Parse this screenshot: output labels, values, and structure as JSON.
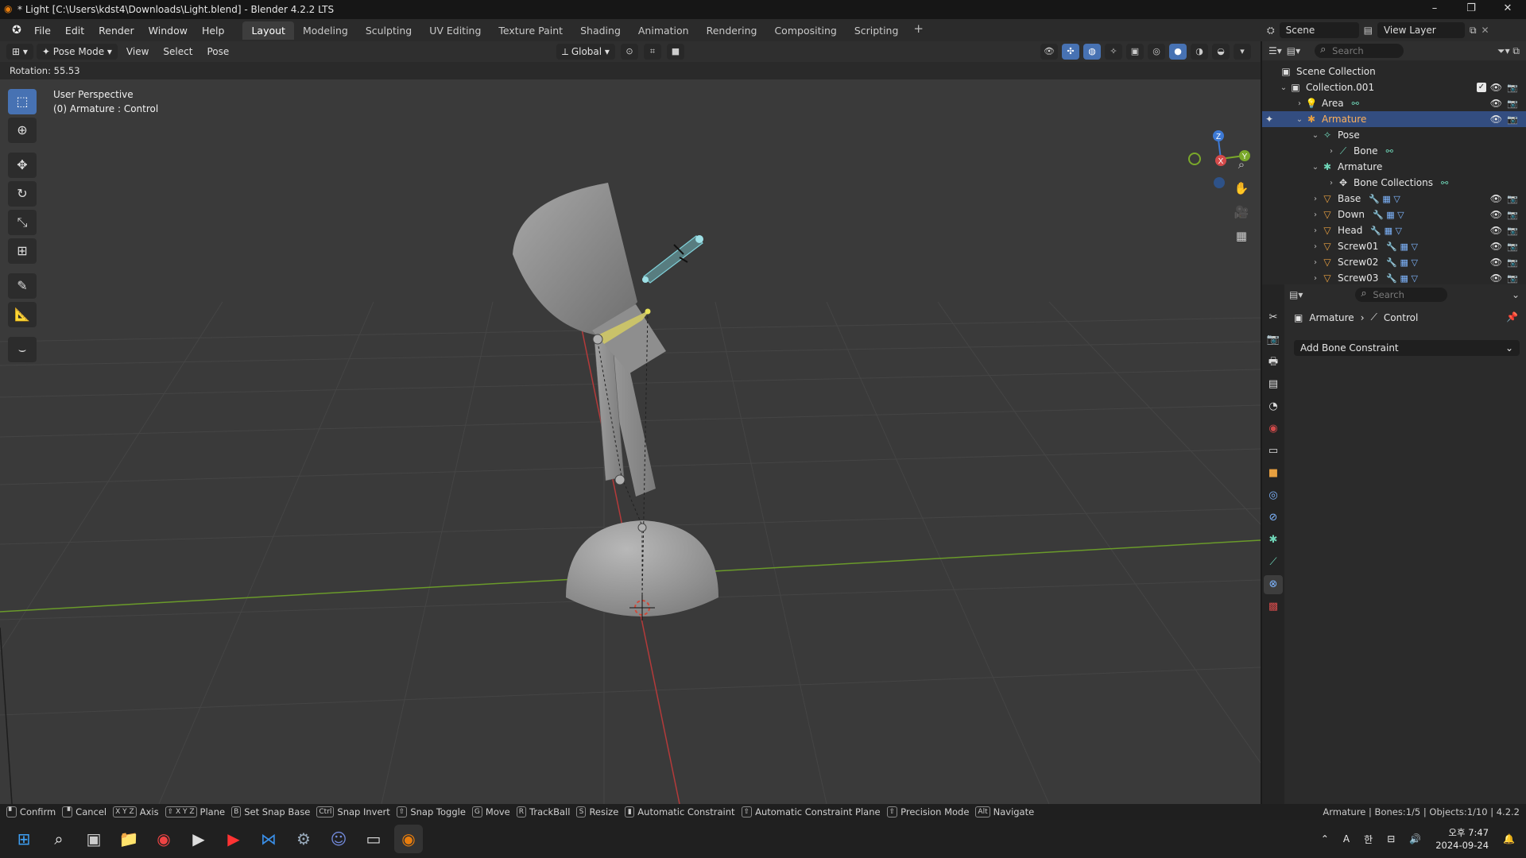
{
  "window": {
    "title": "* Light [C:\\Users\\kdst4\\Downloads\\Light.blend] - Blender 4.2.2 LTS",
    "controls": [
      "–",
      "❐",
      "✕"
    ]
  },
  "menubar": {
    "logo_icon": "blender-logo-icon",
    "menus": [
      "File",
      "Edit",
      "Render",
      "Window",
      "Help"
    ],
    "workspaces": [
      "Layout",
      "Modeling",
      "Sculpting",
      "UV Editing",
      "Texture Paint",
      "Shading",
      "Animation",
      "Rendering",
      "Compositing",
      "Scripting"
    ],
    "active_workspace": "Layout",
    "add_workspace": "+",
    "scene": "Scene",
    "view_layer": "View Layer"
  },
  "viewport": {
    "mode": "Pose Mode",
    "menus": [
      "View",
      "Select",
      "Pose"
    ],
    "transform_orientation": "Global",
    "rotation_readout": "Rotation: 55.53",
    "perspective_label": "User Perspective",
    "active_label": "(0) Armature : Control",
    "axes": {
      "x": "X",
      "y": "Y",
      "z": "Z"
    },
    "colors": {
      "background": "#3a3a3a",
      "grid": "#454545",
      "x_axis": "#b43a3a",
      "y_axis": "#6a9a2a",
      "bone_selected": "#7fd0d8",
      "bone_active_ik": "#c9c26a",
      "mesh": "#9a9a9a"
    }
  },
  "outliner": {
    "search_placeholder": "Search",
    "rows": [
      {
        "label": "Scene Collection",
        "depth": 0,
        "icon": "scene-collection-icon"
      },
      {
        "label": "Collection.001",
        "depth": 1,
        "icon": "collection-icon",
        "expanded": true,
        "checked": true
      },
      {
        "label": "Area",
        "depth": 2,
        "icon": "light-icon"
      },
      {
        "label": "Armature",
        "depth": 2,
        "icon": "armature-icon",
        "expanded": true,
        "selected": true
      },
      {
        "label": "Pose",
        "depth": 3,
        "icon": "pose-icon",
        "expanded": true
      },
      {
        "label": "Bone",
        "depth": 4,
        "icon": "bone-icon"
      },
      {
        "label": "Armature",
        "depth": 3,
        "icon": "armature-data-icon",
        "expanded": true
      },
      {
        "label": "Bone Collections",
        "depth": 4,
        "icon": "bone-collections-icon"
      },
      {
        "label": "Base",
        "depth": 3,
        "icon": "mesh-icon"
      },
      {
        "label": "Down",
        "depth": 3,
        "icon": "mesh-icon"
      },
      {
        "label": "Head",
        "depth": 3,
        "icon": "mesh-icon"
      },
      {
        "label": "Screw01",
        "depth": 3,
        "icon": "mesh-icon"
      },
      {
        "label": "Screw02",
        "depth": 3,
        "icon": "mesh-icon"
      },
      {
        "label": "Screw03",
        "depth": 3,
        "icon": "mesh-icon"
      }
    ]
  },
  "properties": {
    "search_placeholder": "Search",
    "breadcrumb": [
      "Armature",
      "Control"
    ],
    "add_constraint_label": "Add Bone Constraint"
  },
  "statusbar": {
    "items": [
      {
        "key": "",
        "label": "Confirm"
      },
      {
        "key": "",
        "label": "Cancel"
      },
      {
        "key": "X Y Z",
        "label": "Axis"
      },
      {
        "key": "⇧ X Y Z",
        "label": "Plane"
      },
      {
        "key": "B",
        "label": "Set Snap Base"
      },
      {
        "key": "Ctrl",
        "label": "Snap Invert"
      },
      {
        "key": "⇧",
        "label": "Snap Toggle"
      },
      {
        "key": "G",
        "label": "Move"
      },
      {
        "key": "R",
        "label": "TrackBall"
      },
      {
        "key": "S",
        "label": "Resize"
      },
      {
        "key": "",
        "label": "Automatic Constraint"
      },
      {
        "key": "⇧",
        "label": "Automatic Constraint Plane"
      },
      {
        "key": "⇧",
        "label": "Precision Mode"
      },
      {
        "key": "Alt",
        "label": "Navigate"
      }
    ],
    "stats": "Armature | Bones:1/5 | Objects:1/10 | 4.2.2"
  },
  "taskbar": {
    "time": "오후 7:47",
    "date": "2024-09-24",
    "ime_indicator": "A",
    "lang_indicator": "한"
  }
}
